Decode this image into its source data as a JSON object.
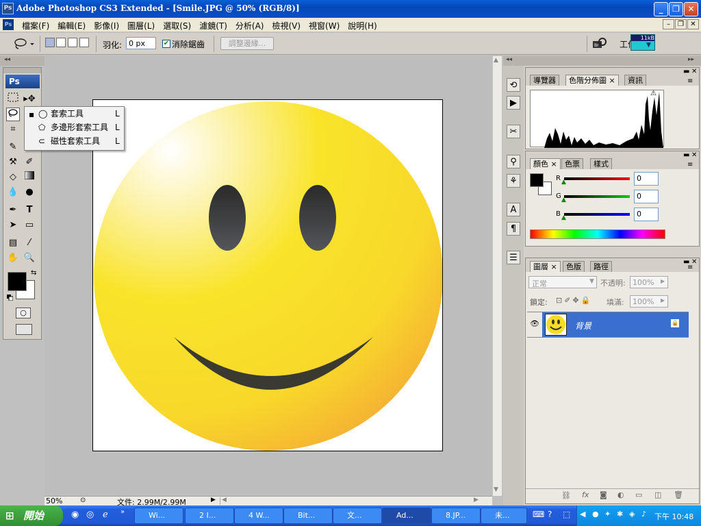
{
  "window": {
    "title": "Adobe Photoshop CS3 Extended - [Smile.JPG @ 50% (RGB/8)]",
    "app_icon_text": "Ps",
    "buttons": [
      "_",
      "❐",
      "✕"
    ]
  },
  "menu": {
    "items": [
      "檔案(F)",
      "編輯(E)",
      "影像(I)",
      "圖層(L)",
      "選取(S)",
      "濾鏡(T)",
      "分析(A)",
      "檢視(V)",
      "視窗(W)",
      "說明(H)"
    ],
    "mdi_buttons": [
      "–",
      "❐",
      "✕"
    ]
  },
  "options": {
    "feather_label": "羽化:",
    "feather_value": "0 px",
    "antialias_label": "消除鋸齒",
    "antialias_checked": true,
    "refine_edge_label": "調整邊緣...",
    "workspace_label": "工作區",
    "kb_badge": "11kB"
  },
  "toolbox": {
    "logo": "Ps"
  },
  "flyout": {
    "items": [
      {
        "label": "套索工具",
        "key": "L",
        "selected": true
      },
      {
        "label": "多邊形套索工具",
        "key": "L",
        "selected": false
      },
      {
        "label": "磁性套索工具",
        "key": "L",
        "selected": false
      }
    ]
  },
  "status": {
    "zoom": "50%",
    "file_info": "文件: 2.99M/2.99M"
  },
  "panels": {
    "navigator_tabs": [
      {
        "label": "導覽器",
        "active": false
      },
      {
        "label": "色階分佈圖",
        "active": true
      },
      {
        "label": "資訊",
        "active": false
      }
    ],
    "color_tabs": [
      {
        "label": "顏色",
        "active": true
      },
      {
        "label": "色票",
        "active": false
      },
      {
        "label": "樣式",
        "active": false
      }
    ],
    "color": {
      "r_label": "R",
      "r_value": "0",
      "g_label": "G",
      "g_value": "0",
      "b_label": "B",
      "b_value": "0"
    },
    "layers_tabs": [
      {
        "label": "圖層",
        "active": true
      },
      {
        "label": "色版",
        "active": false
      },
      {
        "label": "路徑",
        "active": false
      }
    ],
    "layers": {
      "blend_mode": "正常",
      "opacity_label": "不透明:",
      "opacity_value": "100%",
      "lock_label": "鎖定:",
      "fill_label": "填滿:",
      "fill_value": "100%",
      "layer_name": "背景"
    }
  },
  "taskbar": {
    "start_label": "開始",
    "tasks": [
      {
        "label": "Wi...",
        "active": false
      },
      {
        "label": "2 I...",
        "active": false
      },
      {
        "label": "4 W...",
        "active": false
      },
      {
        "label": "Bit...",
        "active": false
      },
      {
        "label": "文...",
        "active": false
      },
      {
        "label": "Ad...",
        "active": true
      },
      {
        "label": "8.JP...",
        "active": false
      },
      {
        "label": "未...",
        "active": false
      }
    ],
    "clock": "下午 10:48"
  },
  "colors": {
    "title_blue": "#0a5fd8",
    "smiley_yellow": "#f9e020",
    "layer_selected": "#3a6fd0"
  }
}
